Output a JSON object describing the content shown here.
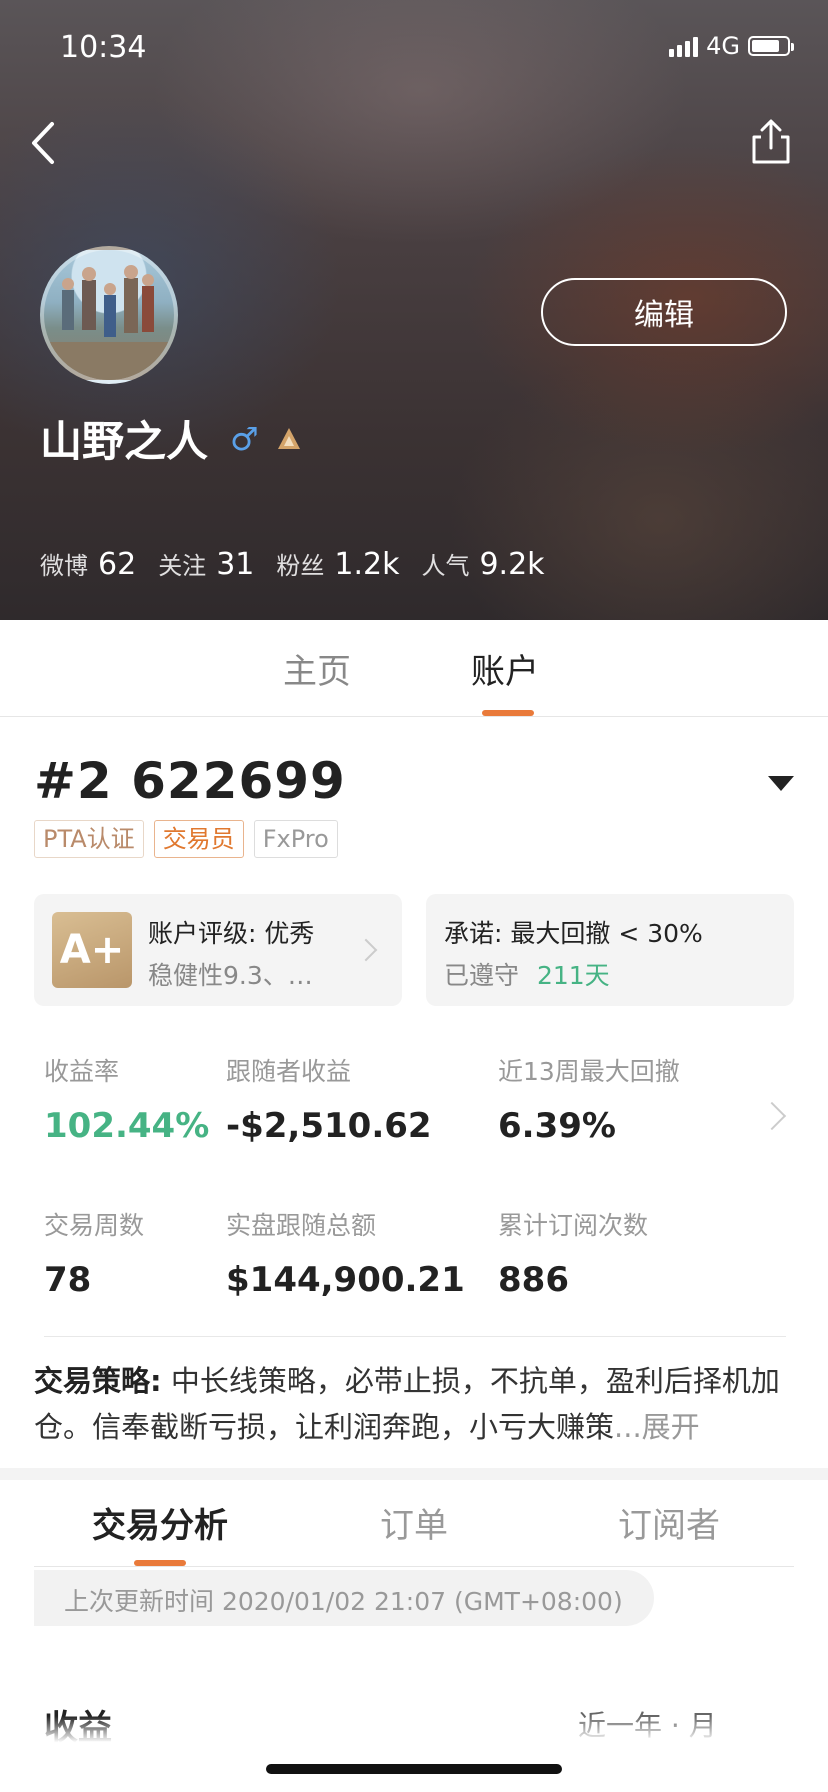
{
  "status_bar": {
    "time": "10:34",
    "network": "4G",
    "battery_level": 0.78
  },
  "header": {
    "edit_label": "编辑",
    "username": "山野之人",
    "gender_symbol": "♂",
    "stats": [
      {
        "label": "微博",
        "value": "62"
      },
      {
        "label": "关注",
        "value": "31"
      },
      {
        "label": "粉丝",
        "value": "1.2k"
      },
      {
        "label": "人气",
        "value": "9.2k"
      }
    ]
  },
  "top_tabs": [
    {
      "label": "主页",
      "active": false
    },
    {
      "label": "账户",
      "active": true
    }
  ],
  "account": {
    "id": "#2 622699",
    "tags": [
      "PTA认证",
      "交易员",
      "FxPro"
    ],
    "rating_card": {
      "grade": "A+",
      "title": "账户评级: 优秀",
      "subtitle": "稳健性9.3、…"
    },
    "promise_card": {
      "title": "承诺: 最大回撤 < 30%",
      "kept_prefix": "已遵守",
      "kept_days": "211天"
    },
    "metrics": [
      {
        "label": "收益率",
        "value": "102.44%"
      },
      {
        "label": "跟随者收益",
        "value": "-$2,510.62"
      },
      {
        "label": "近13周最大回撤",
        "value": "6.39%"
      },
      {
        "label": "交易周数",
        "value": "78"
      },
      {
        "label": "实盘跟随总额",
        "value": "$144,900.21"
      },
      {
        "label": "累计订阅次数",
        "value": "886"
      }
    ],
    "strategy": {
      "label": "交易策略:",
      "text": " 中长线策略，必带止损，不抗单，盈利后择机加仓。信奉截断亏损，让利润奔跑，小亏大赚策",
      "more": "...展开"
    }
  },
  "sub_tabs": [
    {
      "label": "交易分析",
      "active": true
    },
    {
      "label": "订单",
      "active": false
    },
    {
      "label": "订阅者",
      "active": false
    }
  ],
  "update_time": "上次更新时间 2020/01/02 21:07 (GMT+08:00)",
  "income": {
    "title": "收益",
    "range": "近一年 · 月"
  },
  "colors": {
    "accent": "#e97a3a",
    "positive": "#46b384",
    "gender": "#5aa0e8"
  }
}
